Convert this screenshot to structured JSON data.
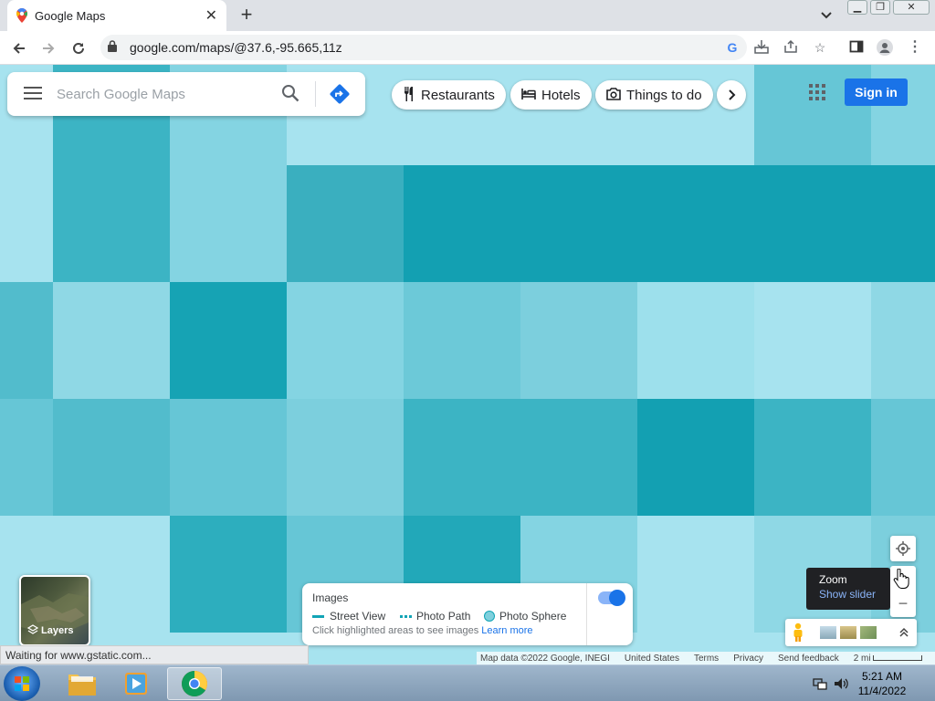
{
  "browser": {
    "tab_title": "Google Maps",
    "tab_close": "✕",
    "new_tab": "+",
    "url": "google.com/maps/@37.6,-95.665,11z"
  },
  "maps": {
    "search_placeholder": "Search Google Maps",
    "chips": [
      {
        "label": "Restaurants",
        "icon": "utensils-icon"
      },
      {
        "label": "Hotels",
        "icon": "bed-icon"
      },
      {
        "label": "Things to do",
        "icon": "camera-icon"
      }
    ],
    "sign_in": "Sign in",
    "layers_label": "Layers",
    "images": {
      "title": "Images",
      "street_view": "Street View",
      "photo_path": "Photo Path",
      "photo_sphere": "Photo Sphere",
      "hint": "Click highlighted areas to see images",
      "learn_more": "Learn more",
      "toggle_on": true
    },
    "zoom_tooltip": {
      "title": "Zoom",
      "action": "Show slider"
    },
    "attribution": {
      "map_data": "Map data ©2022 Google, INEGI",
      "country": "United States",
      "terms": "Terms",
      "privacy": "Privacy",
      "feedback": "Send feedback",
      "scale": "2 mi"
    }
  },
  "status_bar": "Waiting for www.gstatic.com...",
  "taskbar": {
    "time": "5:21 AM",
    "date": "11/4/2022"
  },
  "colors": {
    "accent": "#1a73e8",
    "map_base": "#a7e3ef"
  }
}
